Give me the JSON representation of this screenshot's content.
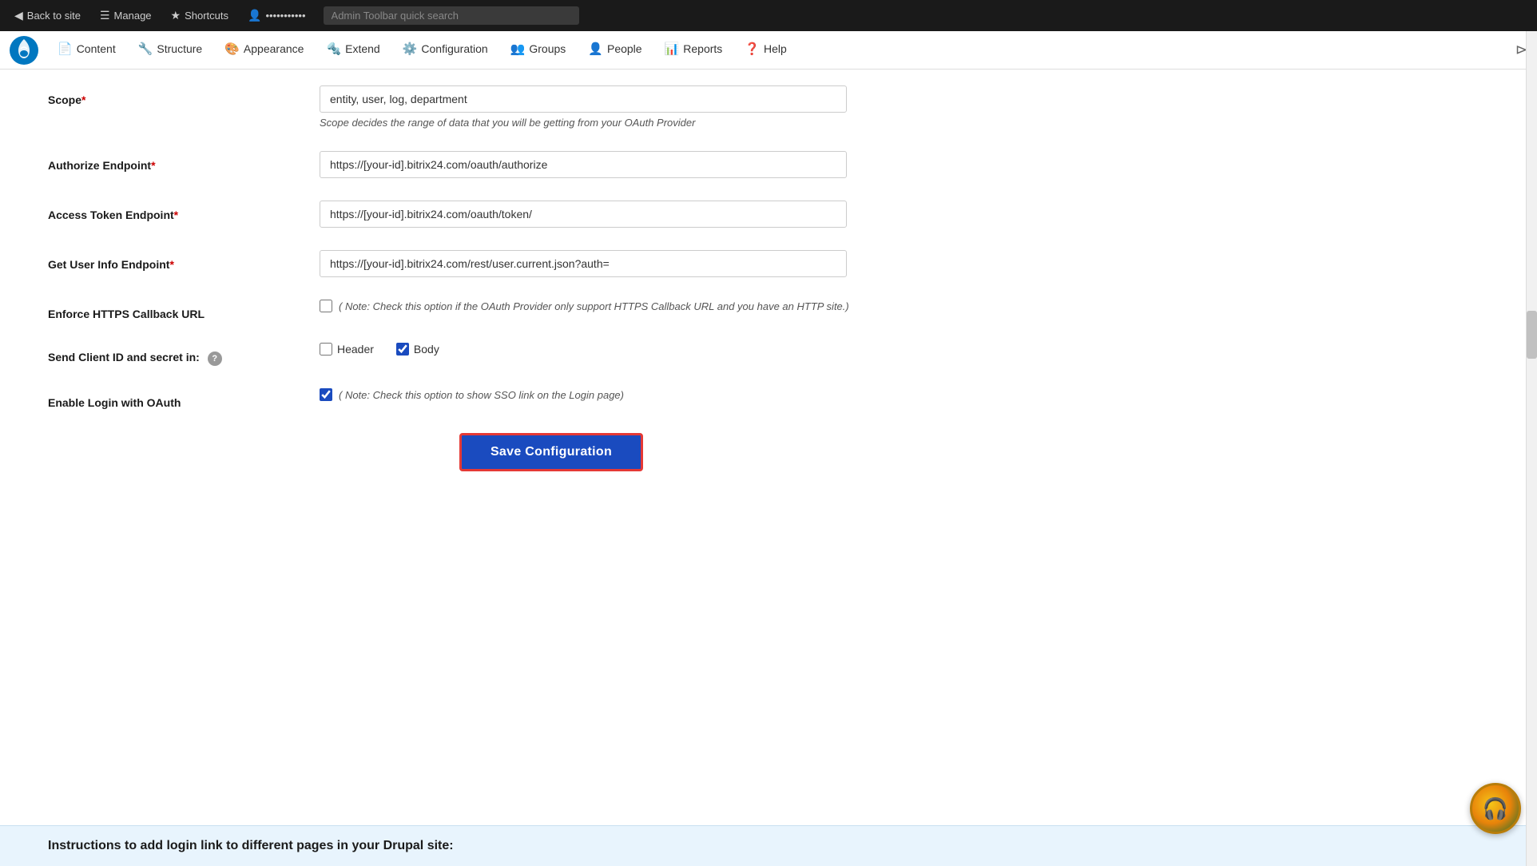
{
  "adminToolbar": {
    "backToSite": "Back to site",
    "manage": "Manage",
    "shortcuts": "Shortcuts",
    "user": "•••••••••••",
    "searchPlaceholder": "Admin Toolbar quick search"
  },
  "drupalNav": {
    "items": [
      {
        "id": "content",
        "label": "Content",
        "icon": "📄"
      },
      {
        "id": "structure",
        "label": "Structure",
        "icon": "🔧"
      },
      {
        "id": "appearance",
        "label": "Appearance",
        "icon": "🎨"
      },
      {
        "id": "extend",
        "label": "Extend",
        "icon": "🔩"
      },
      {
        "id": "configuration",
        "label": "Configuration",
        "icon": "⚙️"
      },
      {
        "id": "groups",
        "label": "Groups",
        "icon": "👥"
      },
      {
        "id": "people",
        "label": "People",
        "icon": "👤"
      },
      {
        "id": "reports",
        "label": "Reports",
        "icon": "📊"
      },
      {
        "id": "help",
        "label": "Help",
        "icon": "❓"
      }
    ]
  },
  "form": {
    "scope": {
      "label": "Scope",
      "required": true,
      "value": "entity, user, log, department",
      "hint": "Scope decides the range of data that you will be getting from your OAuth Provider"
    },
    "authorizeEndpoint": {
      "label": "Authorize Endpoint",
      "required": true,
      "value": "https://[your-id].bitrix24.com/oauth/authorize"
    },
    "accessTokenEndpoint": {
      "label": "Access Token Endpoint",
      "required": true,
      "value": "https://[your-id].bitrix24.com/oauth/token/"
    },
    "getUserInfoEndpoint": {
      "label": "Get User Info Endpoint",
      "required": true,
      "value": "https://[your-id].bitrix24.com/rest/user.current.json?auth="
    },
    "enforceHttps": {
      "label": "Enforce HTTPS Callback URL",
      "checked": false,
      "note": "( Note: Check this option if the OAuth Provider only support HTTPS Callback URL and you have an HTTP site.)"
    },
    "sendClientId": {
      "label": "Send Client ID and secret in:",
      "hasHelp": true,
      "headerChecked": false,
      "headerLabel": "Header",
      "bodyChecked": true,
      "bodyLabel": "Body"
    },
    "enableLogin": {
      "label": "Enable Login with OAuth",
      "checked": true,
      "note": "( Note: Check this option to show SSO link on the Login page)"
    },
    "saveButton": "Save Configuration"
  },
  "instructions": {
    "title": "Instructions to add login link to different pages in your Drupal site:"
  },
  "helpWidget": {
    "icon": "🎧"
  }
}
